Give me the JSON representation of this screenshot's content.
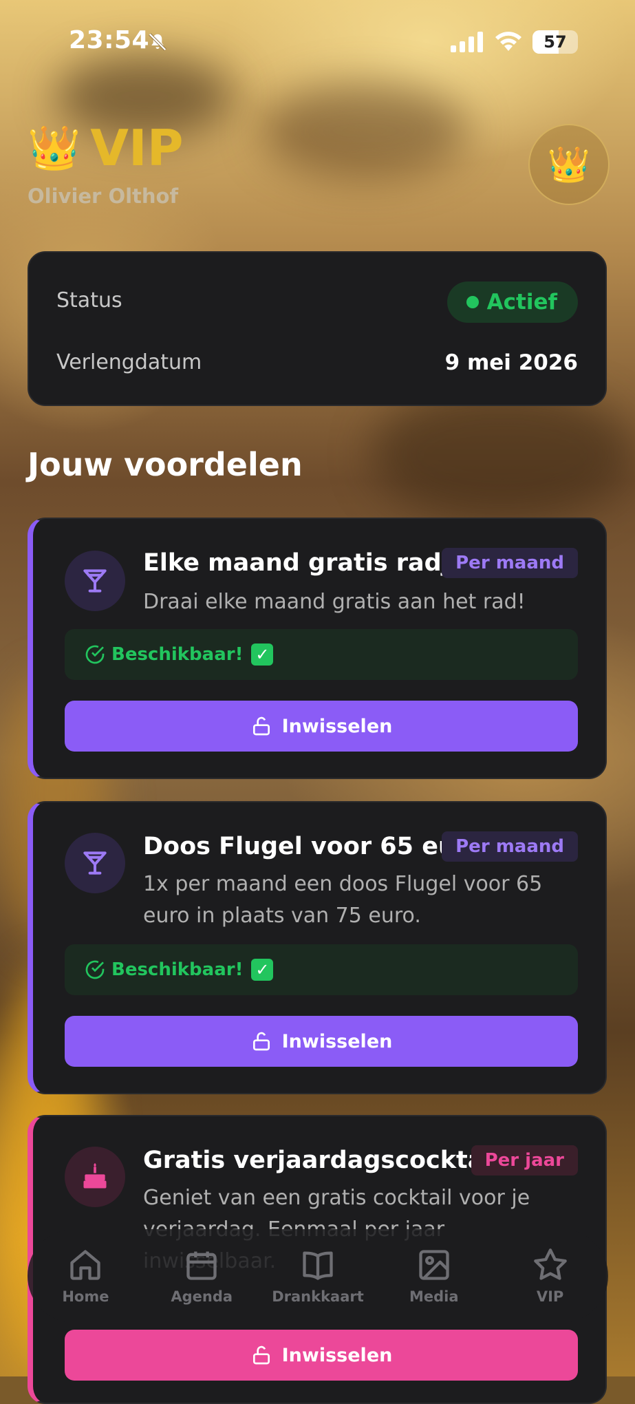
{
  "status_bar": {
    "time": "23:54",
    "battery": "57",
    "battery_level": 0.57
  },
  "header": {
    "crown_emoji": "👑",
    "title": "VIP",
    "subtitle": "Olivier Olthof",
    "avatar_emoji": "👑"
  },
  "membership": {
    "status_label": "Status",
    "status_value": "Actief",
    "renew_label": "Verlengdatum",
    "renew_value": "9 mei 2026"
  },
  "section_title": "Jouw voordelen",
  "benefits": [
    {
      "title": "Elke maand gratis radje",
      "badge": "Per maand",
      "description": "Draai elke maand gratis aan het rad!",
      "availability": "Beschikbaar!",
      "button": "Inwisselen",
      "icon": "cocktail-icon",
      "accent": "#8b5cf6"
    },
    {
      "title": "Doos Flugel voor 65 euro",
      "badge": "Per maand",
      "description": "1x per maand een doos Flugel voor 65 euro in plaats van 75 euro.",
      "availability": "Beschikbaar!",
      "button": "Inwisselen",
      "icon": "cocktail-icon",
      "accent": "#8b5cf6"
    },
    {
      "title": "Gratis verjaardagscocktail",
      "badge": "Per jaar",
      "description": "Geniet van een gratis cocktail voor je verjaardag. Eenmaal per jaar inwisselbaar.",
      "button": "Inwisselen",
      "icon": "cake-icon",
      "accent": "#ec4899"
    }
  ],
  "nav": [
    {
      "label": "Home",
      "icon": "home-icon"
    },
    {
      "label": "Agenda",
      "icon": "calendar-icon"
    },
    {
      "label": "Drankkaart",
      "icon": "book-icon"
    },
    {
      "label": "Media",
      "icon": "image-icon"
    },
    {
      "label": "VIP",
      "icon": "star-icon"
    }
  ]
}
